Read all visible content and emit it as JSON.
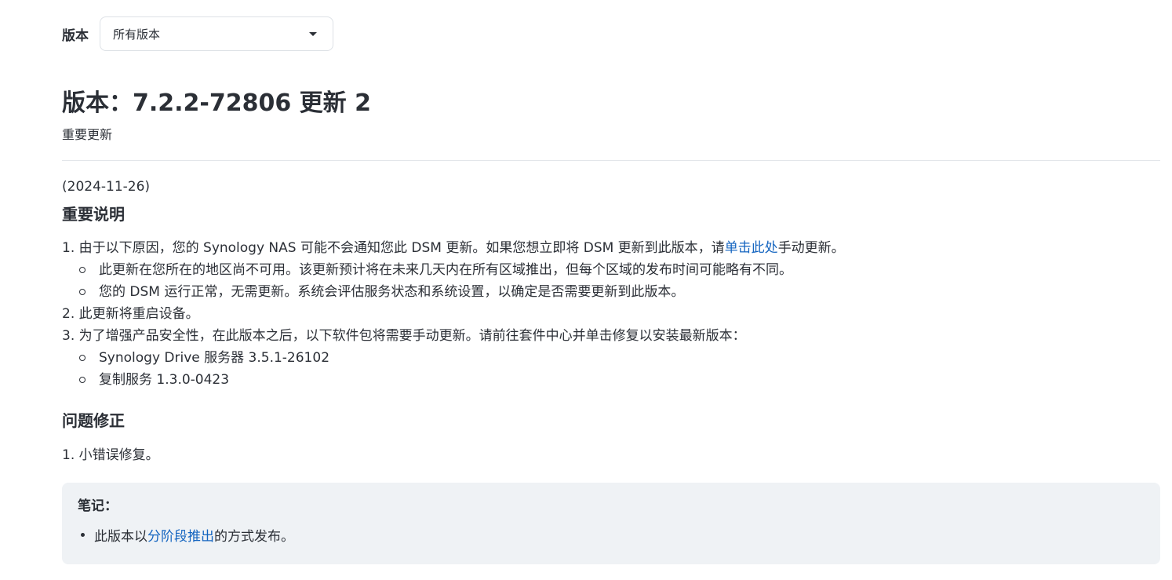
{
  "filter": {
    "label": "版本",
    "selected": "所有版本"
  },
  "release": {
    "title": "版本：7.2.2-72806 更新 2",
    "subtitle": "重要更新",
    "date": "(2024-11-26)"
  },
  "important": {
    "title": "重要说明",
    "item1_before": "1. 由于以下原因，您的 Synology NAS 可能不会通知您此 DSM 更新。如果您想立即将 DSM 更新到此版本，请",
    "item1_link": "单击此处",
    "item1_after": "手动更新。",
    "item1_sub": [
      "此更新在您所在的地区尚不可用。该更新预计将在未来几天内在所有区域推出，但每个区域的发布时间可能略有不同。",
      "您的 DSM 运行正常，无需更新。系统会评估服务状态和系统设置，以确定是否需要更新到此版本。"
    ],
    "item2": "2. 此更新将重启设备。",
    "item3": "3. 为了增强产品安全性，在此版本之后，以下软件包将需要手动更新。请前往套件中心并单击修复以安装最新版本：",
    "item3_sub": [
      "Synology Drive 服务器 3.5.1-26102",
      "复制服务 1.3.0-0423"
    ]
  },
  "fixes": {
    "title": "问题修正",
    "item1": "1. 小错误修复。"
  },
  "note": {
    "label": "笔记：",
    "before": "此版本以",
    "link": "分阶段推出",
    "after": "的方式发布。"
  },
  "colors": {
    "link": "#1565c0",
    "text": "#2b2f36",
    "note_bg": "#eff2f5"
  }
}
